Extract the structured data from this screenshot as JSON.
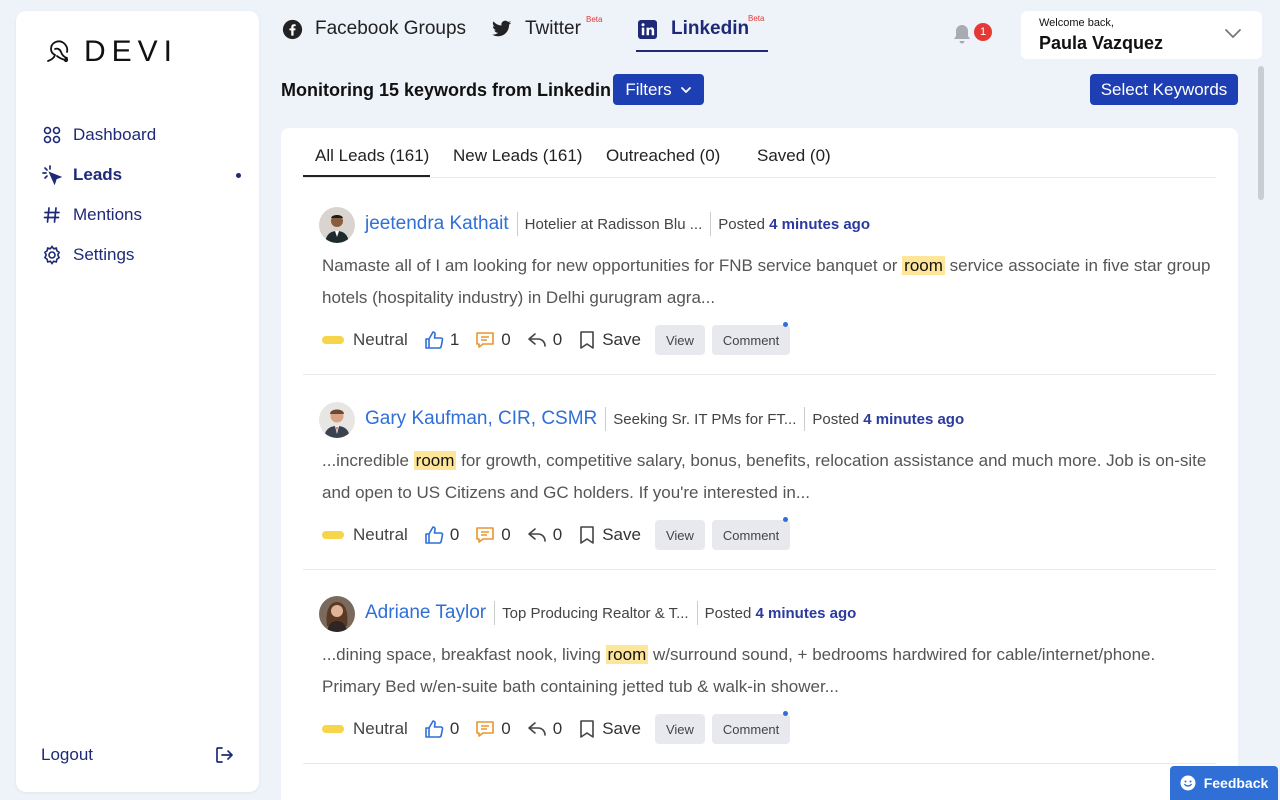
{
  "app": {
    "logo_text": "DEVI"
  },
  "sidebar": {
    "items": [
      {
        "label": "Dashboard",
        "icon": "grid-icon"
      },
      {
        "label": "Leads",
        "icon": "cursor-click-icon",
        "active": true
      },
      {
        "label": "Mentions",
        "icon": "hashtag-icon"
      },
      {
        "label": "Settings",
        "icon": "gear-icon"
      }
    ],
    "logout_label": "Logout"
  },
  "platform_tabs": [
    {
      "label": "Facebook Groups",
      "icon": "facebook-icon"
    },
    {
      "label": "Twitter",
      "icon": "twitter-icon",
      "badge": "Beta"
    },
    {
      "label": "Linkedin",
      "icon": "linkedin-icon",
      "badge": "Beta",
      "active": true
    }
  ],
  "notifications": {
    "count": "1"
  },
  "user": {
    "welcome": "Welcome back,",
    "name": "Paula Vazquez"
  },
  "monitoring": {
    "title": "Monitoring 15 keywords from Linkedin",
    "filters_label": "Filters",
    "select_keywords_label": "Select Keywords"
  },
  "lead_tabs": [
    {
      "label": "All Leads (161)",
      "active": true
    },
    {
      "label": "New Leads (161)"
    },
    {
      "label": "Outreached (0)"
    },
    {
      "label": "Saved (0)"
    }
  ],
  "leads": [
    {
      "name": "jeetendra Kathait",
      "headline": "Hotelier at Radisson Blu ...",
      "posted_prefix": "Posted",
      "posted_time": "4 minutes ago",
      "text_before": "Namaste all of I am looking for new opportunities for FNB service banquet or ",
      "keyword": "room",
      "text_after": " service associate in five star group hotels (hospitality industry) in Delhi gurugram agra...",
      "sentiment": "Neutral",
      "likes": "1",
      "comments": "0",
      "shares": "0",
      "save_label": "Save",
      "view_label": "View",
      "comment_label": "Comment"
    },
    {
      "name": "Gary Kaufman, CIR, CSMR",
      "headline": "Seeking Sr. IT PMs for FT...",
      "posted_prefix": "Posted",
      "posted_time": "4 minutes ago",
      "text_before": "...incredible ",
      "keyword": "room",
      "text_after": " for growth, competitive salary, bonus, benefits, relocation assistance and much more. Job is on-site and open to US Citizens and GC holders. If you're interested in...",
      "sentiment": "Neutral",
      "likes": "0",
      "comments": "0",
      "shares": "0",
      "save_label": "Save",
      "view_label": "View",
      "comment_label": "Comment"
    },
    {
      "name": "Adriane Taylor",
      "headline": "Top Producing Realtor & T...",
      "posted_prefix": "Posted",
      "posted_time": "4 minutes ago",
      "text_before": "...dining space, breakfast nook, living ",
      "keyword": "room",
      "text_after": " w/surround sound, + bedrooms hardwired for cable/internet/phone. Primary Bed w/en-suite bath containing jetted tub & walk-in shower...",
      "sentiment": "Neutral",
      "likes": "0",
      "comments": "0",
      "shares": "0",
      "save_label": "Save",
      "view_label": "View",
      "comment_label": "Comment"
    }
  ],
  "feedback_label": "Feedback",
  "colors": {
    "primary": "#1e3fb4",
    "nav": "#1e2a78",
    "link": "#2f6fd6",
    "highlight": "#fde69a",
    "sentiment_neutral": "#f6d54a"
  }
}
